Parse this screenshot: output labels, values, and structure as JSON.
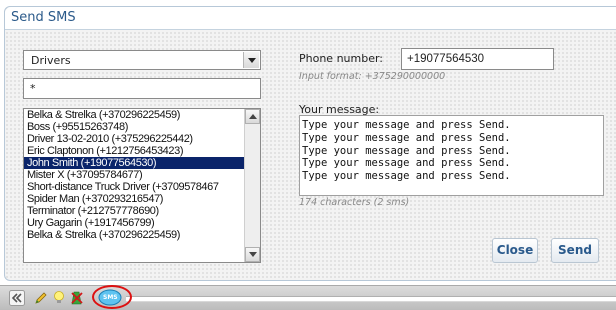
{
  "dialog": {
    "title": "Send SMS"
  },
  "contacts": {
    "group_selected": "Drivers",
    "filter_value": "*",
    "items": [
      "Belka & Strelka (+370296225459)",
      "Boss (+95515263748)",
      "Driver 13-02-2010 (+375296225442)",
      "Eric Claptonon (+1212756453423)",
      "John Smith (+19077564530)",
      "Mister X (+37095784677)",
      "Short-distance Truck Driver (+3709578467",
      "Spider Man (+370293216547)",
      "Terminator (+212757778690)",
      "Ury Gagarin (+1917456799)",
      "Belka & Strelka (+370296225459)"
    ],
    "selected_item": "John Smith (+19077564530)"
  },
  "phone": {
    "label": "Phone number:",
    "value": "+19077564530",
    "hint": "Input format: +375290000000"
  },
  "message": {
    "label": "Your message:",
    "lines": [
      "Type your message and press Send.",
      "Type your message and press Send.",
      "Type your message and press Send.",
      "Type your message and press Send.",
      "Type your message and press Send."
    ],
    "counter": "174 characters (2 sms)"
  },
  "buttons": {
    "close": "Close",
    "send": "Send"
  },
  "toolbar": {
    "icons": [
      "collapse-icon",
      "pencil-icon",
      "lightbulb-icon",
      "remove-marker-icon",
      "sms-icon"
    ],
    "sms_badge": "SMS",
    "highlight_color": "#dd1111"
  }
}
